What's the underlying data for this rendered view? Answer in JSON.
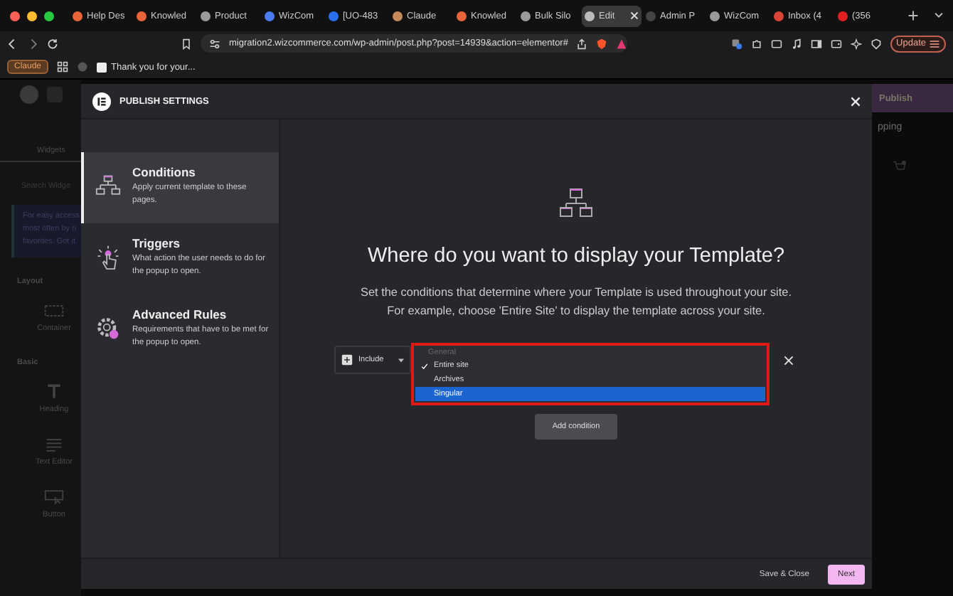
{
  "browser": {
    "tabs": [
      {
        "title": "Help Des",
        "selected": false,
        "color": "#e8653a"
      },
      {
        "title": "Knowled",
        "selected": false,
        "color": "#e8653a"
      },
      {
        "title": "Product",
        "selected": false,
        "color": "#9a9a9a"
      },
      {
        "title": "WizCom",
        "selected": false,
        "color": "#4a7cf0"
      },
      {
        "title": "[UO-483",
        "selected": false,
        "color": "#2a6ff0"
      },
      {
        "title": "Claude",
        "selected": false,
        "color": "#c58a5a"
      },
      {
        "title": "Knowled",
        "selected": false,
        "color": "#e8653a"
      },
      {
        "title": "Bulk Silo",
        "selected": false,
        "color": "#9a9a9a"
      },
      {
        "title": "Edit",
        "selected": true,
        "color": "#bbbbbb"
      },
      {
        "title": "Admin P",
        "selected": false,
        "color": "#444444"
      },
      {
        "title": "WizCom",
        "selected": false,
        "color": "#9a9a9a"
      },
      {
        "title": "Inbox (4",
        "selected": false,
        "color": "#d94436"
      },
      {
        "title": "(356",
        "selected": false,
        "color": "#e02020"
      }
    ],
    "address": "migration2.wizcommerce.com/wp-admin/post.php?post=14939&action=elementor#",
    "update_button": "Update",
    "bookmarks": [
      {
        "label": "Claude",
        "kind": "chip"
      },
      {
        "label": "Thank you for your...",
        "kind": "link"
      }
    ]
  },
  "editor": {
    "panel_tab": "Widgets",
    "search_placeholder": "Search Widge",
    "notice": "For easy access most often by ri favorites. Got it",
    "categories": [
      {
        "title": "Layout",
        "widgets": [
          {
            "label": "Container",
            "kind": "container"
          }
        ]
      },
      {
        "title": "Basic",
        "widgets": [
          {
            "label": "Heading",
            "kind": "heading"
          },
          {
            "label": "Text Editor",
            "kind": "text"
          },
          {
            "label": "Button",
            "kind": "button"
          }
        ]
      }
    ],
    "publish_button": "Publish",
    "page_text": "pping"
  },
  "modal": {
    "title": "PUBLISH SETTINGS",
    "nav": [
      {
        "title": "Conditions",
        "description": "Apply current template to these pages.",
        "kind": "conditions",
        "selected": true
      },
      {
        "title": "Triggers",
        "description": "What action the user needs to do for the popup to open.",
        "kind": "triggers",
        "selected": false
      },
      {
        "title": "Advanced Rules",
        "description": "Requirements that have to be met for the popup to open.",
        "kind": "rules",
        "selected": false
      }
    ],
    "heading": "Where do you want to display your Template?",
    "description": "Set the conditions that determine where your Template is used throughout your site. For example, choose 'Entire Site' to display the template across your site.",
    "condition": {
      "type": "Include",
      "dropdown": {
        "group": "General",
        "options": [
          {
            "label": "Entire site",
            "checked": true,
            "selected": false
          },
          {
            "label": "Archives",
            "checked": false,
            "selected": false
          },
          {
            "label": "Singular",
            "checked": false,
            "selected": true
          }
        ]
      }
    },
    "add_button": "Add condition",
    "save_button": "Save & Close",
    "next_button": "Next"
  }
}
